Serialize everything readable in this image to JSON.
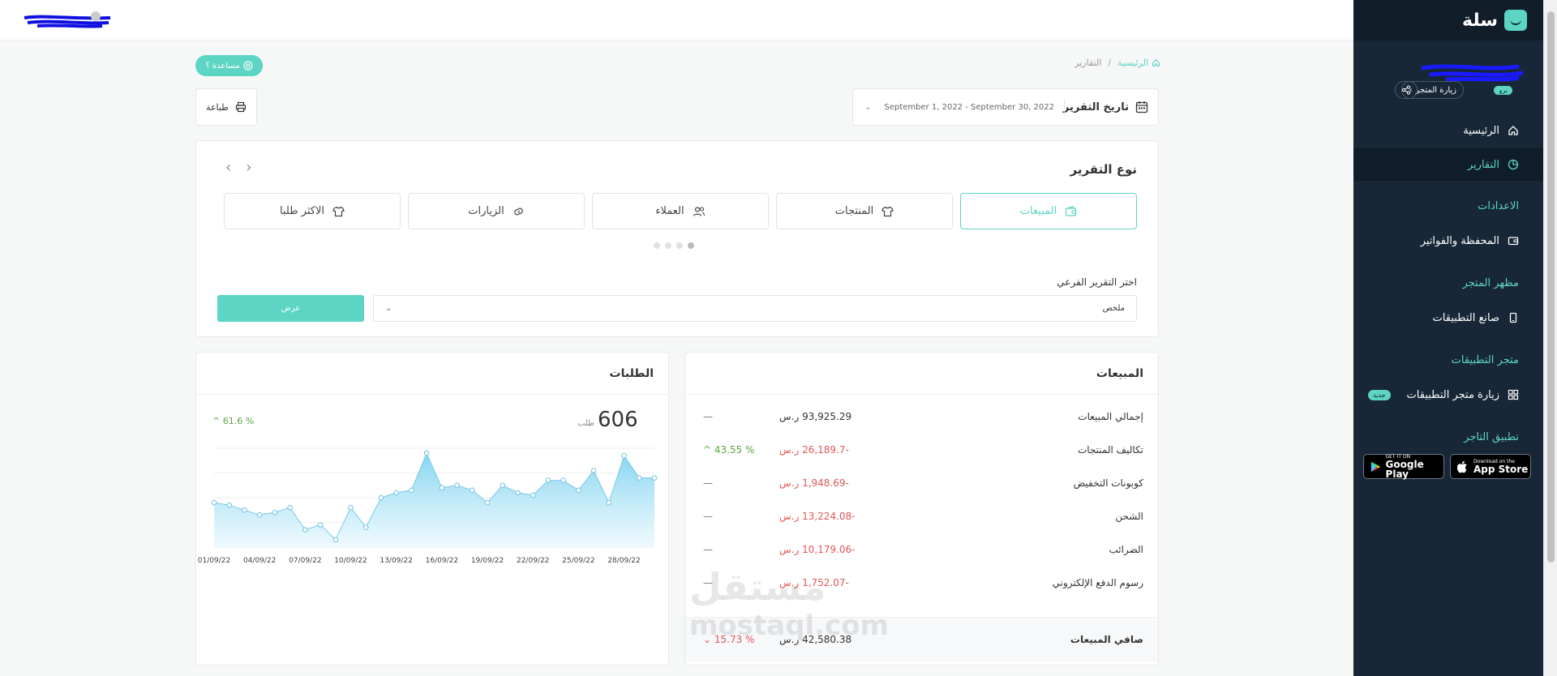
{
  "sidebar": {
    "logo": "سلة",
    "badge": "برو",
    "visit_store": "زيارة المتجر",
    "items": {
      "home": "الرئيسية",
      "reports": "التقارير",
      "wallet": "المحفظة والفواتير",
      "app_builder": "صانع التطبيقات",
      "visit_app_store": "زيارة متجر التطبيقات"
    },
    "sections": {
      "settings": "الاعدادات",
      "store_appearance": "مظهر المتجر",
      "app_store": "متجر التطبيقات",
      "merchant_app": "تطبيق التاجر"
    },
    "new_badge": "جديد",
    "app_store_btn": {
      "small": "Download on the",
      "big": "App Store"
    },
    "google_play_btn": {
      "small": "GET IT ON",
      "big": "Google Play"
    }
  },
  "breadcrumb": {
    "home": "الرئيسية",
    "separator": "/",
    "current": "التقارير"
  },
  "help_button": "مساعدة ؟",
  "print_button": "طباعة",
  "date_filter": {
    "label": "تاريخ التقرير",
    "range": "September 1, 2022 - September 30, 2022"
  },
  "report_type": {
    "title": "نوع التقرير",
    "types": [
      "المبيعات",
      "المنتجات",
      "العملاء",
      "الزيارات",
      "الاكثر طلبا"
    ],
    "sub_label": "اختر التقرير الفرعي",
    "sub_value": "ملخص",
    "show_button": "عرض"
  },
  "orders": {
    "title": "الطلبات",
    "count": "606",
    "unit": "طلب",
    "change": "61.6 %"
  },
  "sales": {
    "title": "المبيعات",
    "rows": [
      {
        "label": "إجمالي المبيعات",
        "value": "93,925.29 ر.س",
        "change": "—"
      },
      {
        "label": "تكاليف المنتجات",
        "value": "-26,189.7 ر.س",
        "change": "43.55 %"
      },
      {
        "label": "كوبونات التخفيض",
        "value": "-1,948.69 ر.س",
        "change": "—"
      },
      {
        "label": "الشحن",
        "value": "-13,224.08 ر.س",
        "change": "—"
      },
      {
        "label": "الضرائب",
        "value": "-10,179.06 ر.س",
        "change": "—"
      },
      {
        "label": "رسوم الدفع الإلكتروني",
        "value": "-1,752.07 ر.س",
        "change": "—"
      }
    ],
    "total": {
      "label": "صافي المبيعات",
      "value": "42,580.38 ر.س",
      "change": "15.73 %"
    }
  },
  "watermark": {
    "ar": "مستقل",
    "en": "mostaql.com"
  },
  "chart_data": {
    "type": "area",
    "x": [
      "01/09/22",
      "02/09/22",
      "03/09/22",
      "04/09/22",
      "05/09/22",
      "06/09/22",
      "07/09/22",
      "08/09/22",
      "09/09/22",
      "10/09/22",
      "11/09/22",
      "12/09/22",
      "13/09/22",
      "14/09/22",
      "15/09/22",
      "16/09/22",
      "17/09/22",
      "18/09/22",
      "19/09/22",
      "20/09/22",
      "21/09/22",
      "22/09/22",
      "23/09/22",
      "24/09/22",
      "25/09/22",
      "26/09/22",
      "27/09/22",
      "28/09/22",
      "29/09/22",
      "30/09/22"
    ],
    "tick_labels": [
      "01/09/22",
      "04/09/22",
      "07/09/22",
      "10/09/22",
      "13/09/22",
      "16/09/22",
      "19/09/22",
      "22/09/22",
      "25/09/22",
      "28/09/22"
    ],
    "series": [
      {
        "values": [
          18,
          17,
          15,
          13,
          14,
          16,
          7,
          9,
          3,
          16,
          8,
          20,
          22,
          23,
          38,
          24,
          25,
          23,
          18,
          25,
          22,
          21,
          27,
          27,
          23,
          31,
          18,
          37,
          28,
          28
        ]
      }
    ],
    "ylim": [
      0,
      40
    ],
    "grid": true,
    "color": "#88d8f0"
  }
}
